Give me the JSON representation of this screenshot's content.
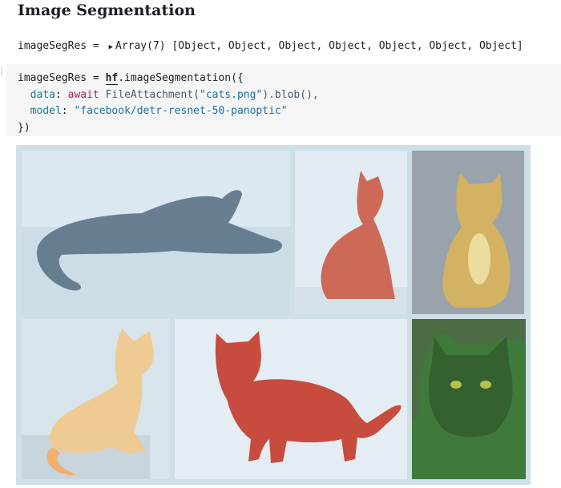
{
  "page": {
    "title": "Image Segmentation"
  },
  "output": {
    "variable": "imageSegRes",
    "equals": "=",
    "array_label": "Array(7)",
    "items_text": "[Object, Object, Object, Object, Object, Object, Object]"
  },
  "code": {
    "line1_var": "imageSegRes",
    "line1_eq": " = ",
    "line1_obj": "hf",
    "line1_method": ".imageSegmentation({",
    "line2_key": "data",
    "line2_colon": ": ",
    "line2_kw": "await",
    "line2_fn": " FileAttachment(",
    "line2_str": "\"cats.png\"",
    "line2_rest": ").blob(),",
    "line3_key": "model",
    "line3_colon": ": ",
    "line3_str": "\"facebook/detr-resnet-50-panoptic\"",
    "line4": "})"
  },
  "segment_colors": {
    "background": "#dbe8f0",
    "wall": "#c9dce8",
    "cat_gray": "#5c7286",
    "cat_red": "#c9533c",
    "cat_orange": "#d9b45a",
    "cat_cream": "#f0c98e",
    "cat_green": "#3f7a3a"
  },
  "icons": {
    "expand": "triangle-right-icon"
  }
}
